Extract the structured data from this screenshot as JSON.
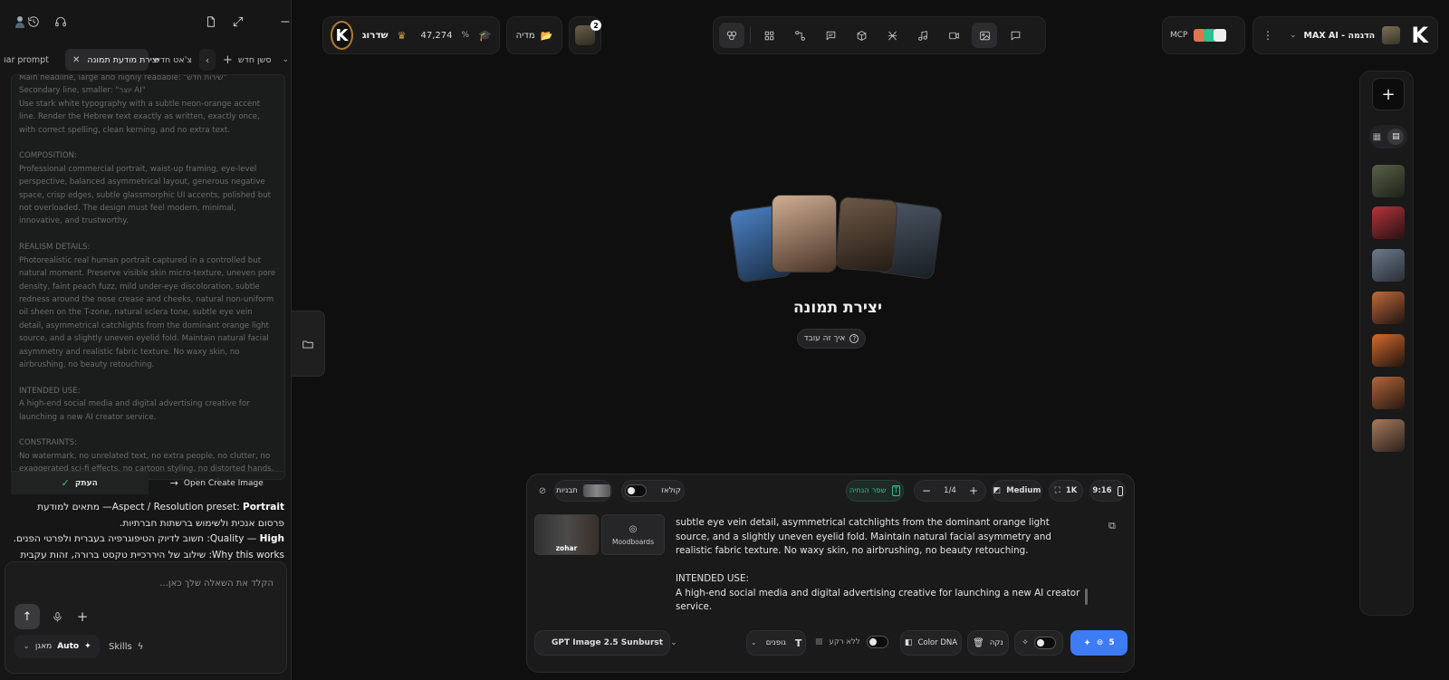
{
  "left_panel": {
    "tabs": {
      "new_session": "סשן חדש",
      "new_chat": "צ'אט חדש",
      "prompt_tab": "יצירת מודעת תמונה",
      "partial_tab": "ıar prompt"
    },
    "prompt_text": "Main headline, large and highly readable: \"שירות חדש\"\nSecondary line, smaller: \"יוצר AI\"\nUse stark white typography with a subtle neon-orange accent line. Render the Hebrew text exactly as written, exactly once, with correct spelling, clean kerning, and no extra text.\n\nCOMPOSITION:\nProfessional commercial portrait, waist-up framing, eye-level perspective, balanced asymmetrical layout, generous negative space, crisp edges, subtle glassmorphic UI accents, polished but not overloaded. The design must feel modern, minimal, innovative, and trustworthy.\n\nREALISM DETAILS:\nPhotorealistic real human portrait captured in a controlled but natural moment. Preserve visible skin micro-texture, uneven pore density, faint peach fuzz, mild under-eye discoloration, subtle redness around the nose crease and cheeks, natural non-uniform oil sheen on the T-zone, natural sclera tone, subtle eye vein detail, asymmetrical catchlights from the dominant orange light source, and a slightly uneven eyelid fold. Maintain natural facial asymmetry and realistic fabric texture. No waxy skin, no airbrushing, no beauty retouching.\n\nINTENDED USE:\nA high-end social media and digital advertising creative for launching a new AI creator service.\n\nCONSTRAINTS:\nNo watermark, no unrelated text, no extra people, no clutter, no exaggerated sci-fi effects, no cartoon styling, no distorted hands, no duplicated facial features, no logos or trademarks.",
    "copy_button": "העתק",
    "open_button": "Open Create Image",
    "chat_line1_pre": "Aspect / Resolution preset: ",
    "chat_line1_bold": "Portrait",
    "chat_line1_rtl": " — מתאים למודעת פרסום אנכית ולשימוש ברשתות חברתיות.",
    "chat_line2_bold": "High",
    "chat_line2_rest": " — Quality: חשוב לדיוק הטיפוגרפיה בעברית ולפרטי הפנים.",
    "chat_line3": "Why this works: שילוב של היררכיית טקסט ברורה, זהות עקבית של",
    "input_placeholder": "הקלד את השאלה שלך כאן...",
    "auto_label": "Auto",
    "model_label": "מאגן",
    "skills_label": "Skills"
  },
  "top": {
    "profile_label": "MAX AI - הדגמה",
    "mcp_label": "MCP",
    "credits": "47,274",
    "upgrade": "שדרוג",
    "media": "מדיה",
    "badge": "2"
  },
  "hero": {
    "title": "יצירת תמונה",
    "how_it_works": "איך זה עובד"
  },
  "composer": {
    "templates_label": "תבניות",
    "collage_label": "קולאז",
    "improve_label": "שפר הנחיה",
    "count": "1/4",
    "quality": "Medium",
    "resolution": "1K",
    "aspect": "9:16",
    "ref_name": "zohar",
    "moodboards": "Moodboards",
    "prompt_text": "subtle eye vein detail, asymmetrical catchlights from the dominant orange light source, and a slightly uneven eyelid fold. Maintain natural facial asymmetry and realistic fabric texture. No waxy skin, no airbrushing, no beauty retouching.\n\nINTENDED USE:\nA high-end social media and digital advertising creative for launching a new AI creator service.",
    "model": "GPT Image 2.5 Sunburst",
    "fonts": "גופנים",
    "no_bg": "ללא רקע",
    "color_dna": "Color DNA",
    "clear": "נקה",
    "generate_count": "5"
  },
  "colors": {
    "accent_blue": "#3d7cf5",
    "accent_green": "#2fbf8f",
    "panel": "#1a1a1b",
    "gold": "#d9a441"
  }
}
